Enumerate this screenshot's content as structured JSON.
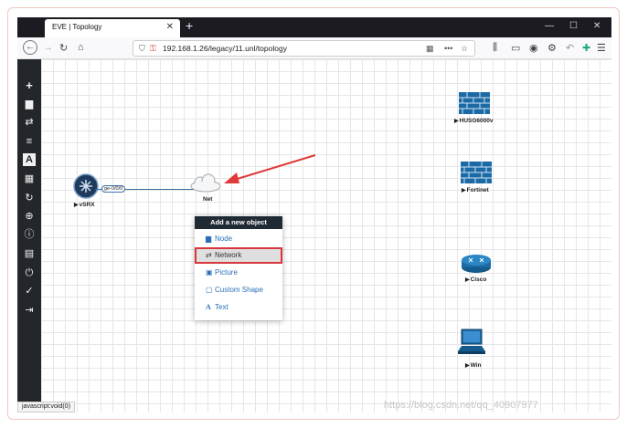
{
  "browser": {
    "tab_title": "EVE | Topology",
    "tab_close": "✕",
    "new_tab": "+",
    "url": "192.168.1.26/legacy/11.unl/topology",
    "status_text": "javascript:void(0)"
  },
  "topology": {
    "nodes": [
      {
        "name": "vSRX"
      },
      {
        "name": "Net"
      },
      {
        "name": "HUSG6000v"
      },
      {
        "name": "Fortinet"
      },
      {
        "name": "Cisco"
      },
      {
        "name": "Win"
      }
    ],
    "link_label": "ge-0/0/0"
  },
  "context_menu": {
    "title": "Add a new object",
    "items": [
      {
        "label": "Node",
        "icon": "node-icon"
      },
      {
        "label": "Network",
        "icon": "network-icon"
      },
      {
        "label": "Picture",
        "icon": "picture-icon"
      },
      {
        "label": "Custom Shape",
        "icon": "custom-shape-icon"
      },
      {
        "label": "Text",
        "icon": "text-icon"
      }
    ]
  },
  "sidebar": {
    "icons": [
      "add-icon",
      "node-list-icon",
      "network-list-icon",
      "startup-config-icon",
      "text-list-icon",
      "grid-icon",
      "refresh-icon",
      "zoom-icon",
      "info-icon",
      "notes-icon",
      "power-icon",
      "lock-icon",
      "logout-icon"
    ]
  },
  "watermark": "https://blog.csdn.net/qq_40907977",
  "colors": {
    "accent": "#2b6fb6",
    "highlight_border": "#d9363e",
    "sidebar_bg": "#23272b"
  }
}
